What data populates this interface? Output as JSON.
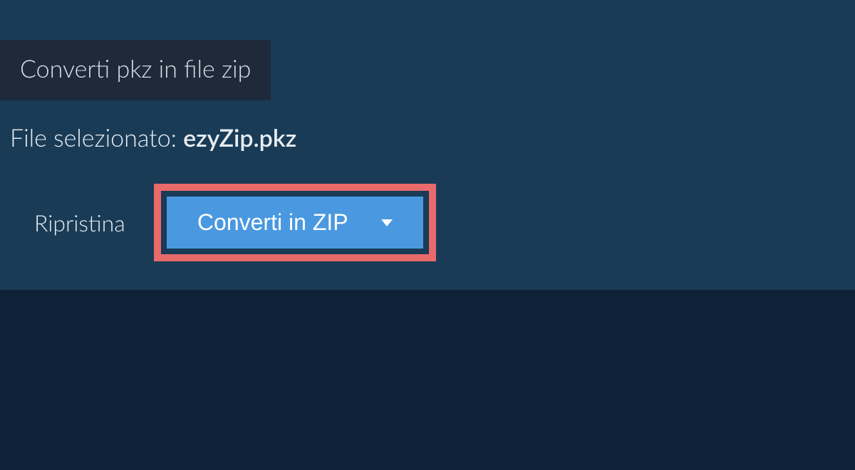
{
  "tab": {
    "label": "Converti pkz in file zip"
  },
  "file": {
    "label_prefix": "File selezionato: ",
    "name": "ezyZip.pkz"
  },
  "actions": {
    "reset_label": "Ripristina",
    "convert_label": "Converti in ZIP"
  }
}
